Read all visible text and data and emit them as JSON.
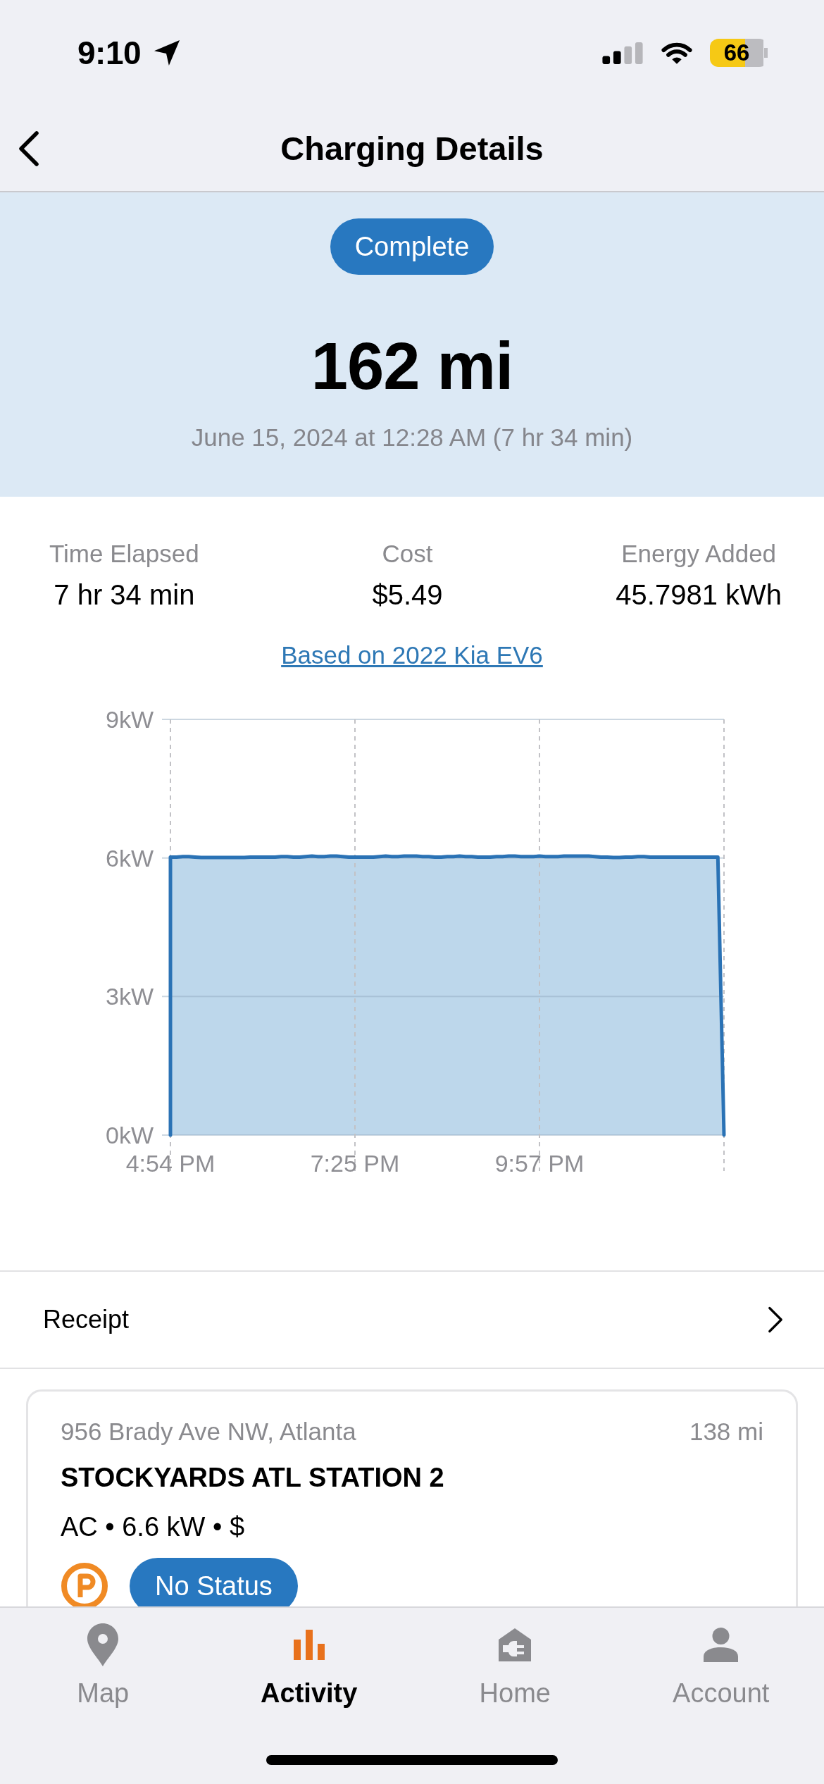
{
  "status_bar": {
    "time": "9:10",
    "battery": "66"
  },
  "nav": {
    "title": "Charging Details"
  },
  "session": {
    "status": "Complete",
    "range_added": "162 mi",
    "date": "June 15, 2024 at 12:28 AM (7 hr 34 min)"
  },
  "stats": [
    {
      "label": "Time Elapsed",
      "value": "7 hr 34 min"
    },
    {
      "label": "Cost",
      "value": "$5.49"
    },
    {
      "label": "Energy Added",
      "value": "45.7981 kWh"
    }
  ],
  "vehicle_link": "Based on 2022 Kia EV6",
  "power_chart": {
    "chart_data": {
      "type": "area",
      "grid": true,
      "categories": [
        "4:54 PM",
        null,
        null,
        null,
        null,
        null,
        null,
        null,
        null,
        null,
        null,
        null,
        null,
        null,
        null,
        null,
        null,
        null,
        null,
        null,
        null,
        null,
        null,
        null,
        null,
        null,
        null,
        null,
        null,
        null,
        "7:25 PM",
        null,
        null,
        null,
        null,
        null,
        null,
        null,
        null,
        null,
        null,
        null,
        null,
        null,
        null,
        null,
        null,
        null,
        null,
        null,
        null,
        null,
        null,
        null,
        null,
        null,
        null,
        null,
        null,
        null,
        "9:57 PM",
        null,
        null,
        null,
        null,
        null,
        null,
        null,
        null,
        null,
        null,
        null,
        null,
        null,
        null,
        null,
        null,
        null,
        null,
        null,
        null,
        null,
        null,
        null,
        null,
        null,
        null,
        null,
        null,
        null,
        null
      ],
      "values": [
        6.02,
        6.02,
        6.03,
        6.03,
        6.02,
        6.01,
        6.01,
        6.01,
        6.01,
        6.01,
        6.01,
        6.01,
        6.01,
        6.02,
        6.02,
        6.02,
        6.02,
        6.02,
        6.03,
        6.03,
        6.02,
        6.02,
        6.03,
        6.04,
        6.03,
        6.03,
        6.04,
        6.04,
        6.03,
        6.02,
        6.02,
        6.02,
        6.02,
        6.02,
        6.03,
        6.04,
        6.03,
        6.03,
        6.04,
        6.04,
        6.04,
        6.03,
        6.03,
        6.02,
        6.02,
        6.03,
        6.03,
        6.04,
        6.03,
        6.03,
        6.02,
        6.02,
        6.02,
        6.03,
        6.03,
        6.04,
        6.04,
        6.03,
        6.03,
        6.03,
        6.04,
        6.03,
        6.03,
        6.03,
        6.04,
        6.04,
        6.04,
        6.04,
        6.04,
        6.03,
        6.02,
        6.02,
        6.01,
        6.01,
        6.02,
        6.02,
        6.03,
        6.03,
        6.02,
        6.02,
        6.02,
        6.02,
        6.02,
        6.02,
        6.02,
        6.02,
        6.02,
        6.02,
        6.02,
        6.02,
        0
      ],
      "ylim": [
        0,
        9
      ],
      "yticks": [
        {
          "value": 0,
          "label": "0kW"
        },
        {
          "value": 3,
          "label": "3kW"
        },
        {
          "value": 6,
          "label": "6kW"
        },
        {
          "value": 9,
          "label": "9kW"
        }
      ]
    }
  },
  "receipt_row": {
    "label": "Receipt"
  },
  "station": {
    "address": "956 Brady Ave NW, Atlanta",
    "distance": "138 mi",
    "name": "STOCKYARDS ATL STATION 2",
    "specs": "AC • 6.6 kW • $",
    "status": "No Status"
  },
  "tab_bar": [
    {
      "label": "Map",
      "selected": false
    },
    {
      "label": "Activity",
      "selected": true
    },
    {
      "label": "Home",
      "selected": false
    },
    {
      "label": "Account",
      "selected": false
    }
  ]
}
